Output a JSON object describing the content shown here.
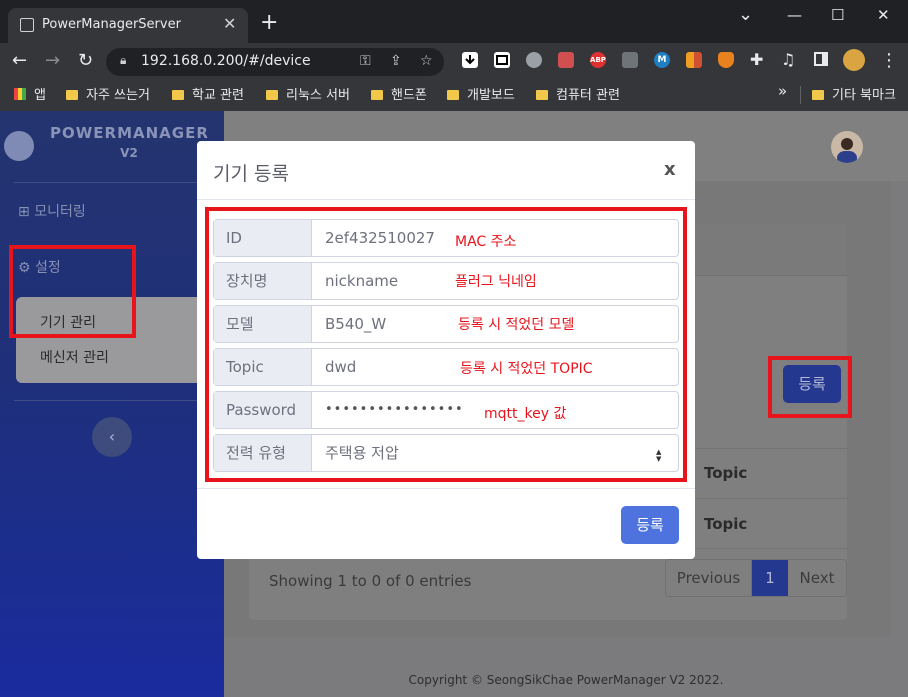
{
  "browser": {
    "tab_title": "PowerManagerServer",
    "tab_close": "✕",
    "new_tab": "+",
    "url": "192.168.0.200/#/device",
    "window_controls": {
      "minimize": "—",
      "maximize": "☐",
      "close": "✕",
      "tabs_menu": "⌄"
    },
    "nav": {
      "back": "←",
      "forward": "→",
      "reload": "↻",
      "menu": "⋮"
    },
    "bookmarks": [
      {
        "label": "앱",
        "icon": "apps-grid-icon"
      },
      {
        "label": "자주 쓰는거",
        "icon": "folder-icon"
      },
      {
        "label": "학교 관련",
        "icon": "folder-icon"
      },
      {
        "label": "리눅스 서버",
        "icon": "folder-icon"
      },
      {
        "label": "핸드폰",
        "icon": "folder-icon"
      },
      {
        "label": "개발보드",
        "icon": "folder-icon"
      },
      {
        "label": "컴퓨터 관련",
        "icon": "folder-icon"
      }
    ],
    "bookmarks_overflow": "»",
    "other_bookmarks": "기타 북마크",
    "extensions": [
      {
        "name": "download-extension-icon",
        "color": "#ffffff"
      },
      {
        "name": "window-extension-icon",
        "color": "#ffffff"
      },
      {
        "name": "camera-extension-icon",
        "color": "#cfd1d5"
      },
      {
        "name": "printer-extension-icon",
        "color": "#d05050"
      },
      {
        "name": "adblock-plus-icon",
        "color": "#e03030",
        "text": "ABP"
      },
      {
        "name": "puzzle-gray-extension-icon",
        "color": "#9aa0a6"
      },
      {
        "name": "m-extension-icon",
        "color": "#1f7fc1",
        "text": "M"
      },
      {
        "name": "grid-extension-icon",
        "color": "#f0a020"
      },
      {
        "name": "metamask-fox-icon",
        "color": "#e8821e"
      },
      {
        "name": "extensions-puzzle-icon",
        "color": "#e8eaed"
      },
      {
        "name": "media-queue-icon",
        "color": "#e8eaed"
      },
      {
        "name": "sidepanel-icon",
        "color": "#e8eaed"
      },
      {
        "name": "profile-doge-avatar-icon",
        "color": "#d9a441"
      }
    ]
  },
  "sidebar": {
    "brand": "POWERMANAGER",
    "brand_sub": "V2",
    "items": [
      {
        "label": "모니터링",
        "icon": "grid-icon"
      },
      {
        "label": "설정",
        "icon": "gear-icon"
      }
    ],
    "submenu": [
      "기기 관리",
      "메신저 관리"
    ],
    "collapse": "‹"
  },
  "main": {
    "register_button": "등록",
    "table_headers": [
      "Topic",
      "Topic"
    ],
    "showing": "Showing 1 to 0 of 0 entries",
    "pagination": {
      "previous": "Previous",
      "page": "1",
      "next": "Next"
    },
    "footer": "Copyright © SeongSikChae PowerManager V2 2022."
  },
  "modal": {
    "title": "기기 등록",
    "close": "x",
    "fields": [
      {
        "label": "ID",
        "value": "2ef432510027",
        "annotation": "MAC 주소"
      },
      {
        "label": "장치명",
        "value": "nickname",
        "annotation": "플러그 닉네임"
      },
      {
        "label": "모델",
        "value": "B540_W",
        "annotation": "등록 시 적었던 모델"
      },
      {
        "label": "Topic",
        "value": "dwd",
        "annotation": "등록 시 적었던 TOPIC"
      },
      {
        "label": "Password",
        "value": "••••••••••••••••",
        "annotation": "mqtt_key 값"
      },
      {
        "label": "전력 유형",
        "value": "주택용 저압",
        "annotation": ""
      }
    ],
    "submit": "등록"
  },
  "colors": {
    "highlight_red": "#e8141c",
    "primary_blue": "#4e73df"
  }
}
